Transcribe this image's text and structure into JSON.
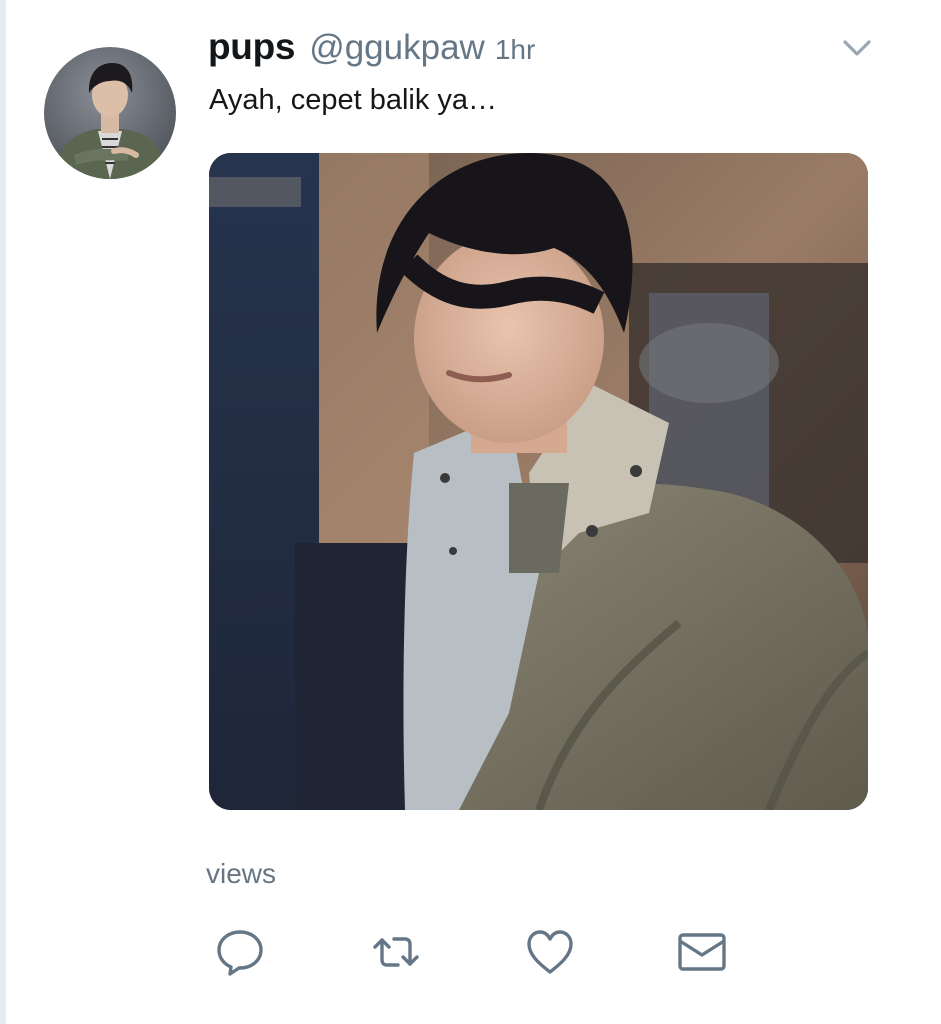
{
  "tweet": {
    "display_name": "pups",
    "handle": "@ggukpaw",
    "time": "1hr",
    "text": "Ayah, cepet balik ya…",
    "views_label": "views"
  },
  "icons": {
    "caret": "chevron-down-icon",
    "reply": "reply-icon",
    "retweet": "retweet-icon",
    "like": "heart-icon",
    "dm": "envelope-icon"
  },
  "colors": {
    "text_primary": "#14171a",
    "text_secondary": "#657786",
    "icon": "#657786",
    "background": "#ffffff"
  }
}
